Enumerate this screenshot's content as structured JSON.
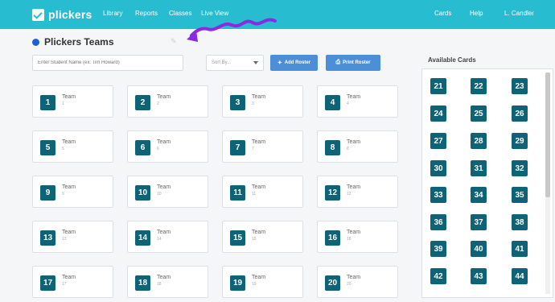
{
  "nav": {
    "brand": "plickers",
    "links": [
      "Library",
      "Reports",
      "Classes",
      "Live View"
    ],
    "right_links": [
      "Cards",
      "Help",
      "L. Candler"
    ]
  },
  "page": {
    "title": "Plickers Teams",
    "search_placeholder": "Enter Student Name (ex: Tim Howard)",
    "sort_label": "Sort By...",
    "add_roster_label": "Add Roster",
    "print_roster_label": "Print Roster"
  },
  "teams": [
    {
      "badge": "1",
      "name": "Team",
      "num": "1"
    },
    {
      "badge": "2",
      "name": "Team",
      "num": "2"
    },
    {
      "badge": "3",
      "name": "Team",
      "num": "3"
    },
    {
      "badge": "4",
      "name": "Team",
      "num": "4"
    },
    {
      "badge": "5",
      "name": "Team",
      "num": "5"
    },
    {
      "badge": "6",
      "name": "Team",
      "num": "6"
    },
    {
      "badge": "7",
      "name": "Team",
      "num": "7"
    },
    {
      "badge": "8",
      "name": "Team",
      "num": "8"
    },
    {
      "badge": "9",
      "name": "Team",
      "num": "9"
    },
    {
      "badge": "10",
      "name": "Team",
      "num": "10"
    },
    {
      "badge": "11",
      "name": "Team",
      "num": "11"
    },
    {
      "badge": "12",
      "name": "Team",
      "num": "12"
    },
    {
      "badge": "13",
      "name": "Team",
      "num": "13"
    },
    {
      "badge": "14",
      "name": "Team",
      "num": "14"
    },
    {
      "badge": "15",
      "name": "Team",
      "num": "15"
    },
    {
      "badge": "16",
      "name": "Team",
      "num": "16"
    },
    {
      "badge": "17",
      "name": "Team",
      "num": "17"
    },
    {
      "badge": "18",
      "name": "Team",
      "num": "18"
    },
    {
      "badge": "19",
      "name": "Team",
      "num": "19"
    },
    {
      "badge": "20",
      "name": "Team",
      "num": "20"
    }
  ],
  "available": {
    "title": "Available Cards",
    "cards": [
      "21",
      "22",
      "23",
      "24",
      "25",
      "26",
      "27",
      "28",
      "29",
      "30",
      "31",
      "32",
      "33",
      "34",
      "35",
      "36",
      "37",
      "38",
      "39",
      "40",
      "41",
      "42",
      "43",
      "44"
    ]
  },
  "colors": {
    "nav_bg": "#27bcd0",
    "badge_bg": "#0f6376",
    "button_bg": "#4d8ed8",
    "title_dot": "#1e5fd6",
    "annotation_arrow": "#8a2be2"
  },
  "icons": {
    "pencil": "pencil-icon",
    "add_roster": "magic-wand-icon",
    "print": "printer-icon",
    "arrow": "purple-squiggle-arrow"
  }
}
